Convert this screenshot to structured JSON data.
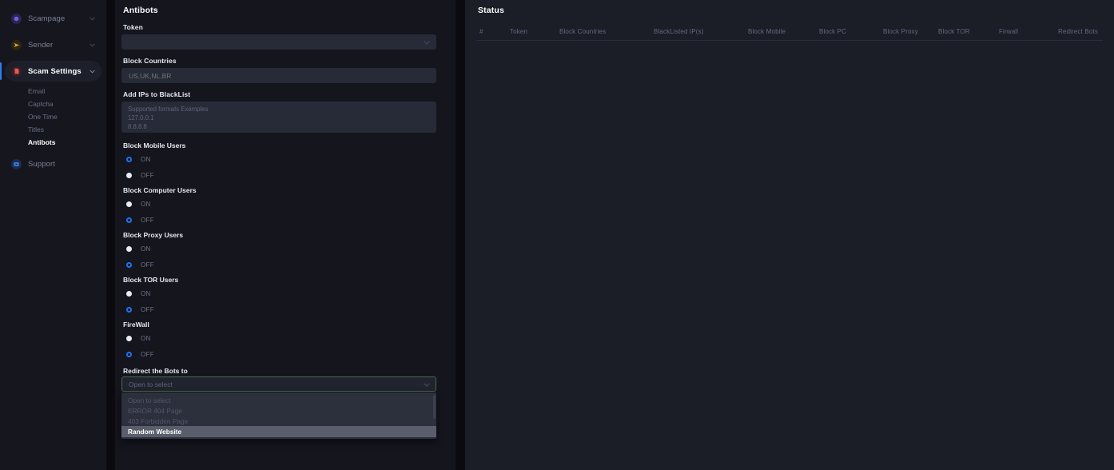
{
  "sidebar": {
    "items": [
      {
        "label": "Scampage",
        "icon": "scampage-icon",
        "badge_color": "#5b4ed6",
        "expandable": true,
        "active": false
      },
      {
        "label": "Sender",
        "icon": "send-icon",
        "badge_color": "#d99a2b",
        "expandable": true,
        "active": false
      },
      {
        "label": "Scam Settings",
        "icon": "document-icon",
        "badge_color": "#d9534f",
        "expandable": true,
        "active": true
      },
      {
        "label": "Support",
        "icon": "support-icon",
        "badge_color": "#2f6fd0",
        "expandable": false,
        "active": false
      }
    ],
    "subitems": [
      {
        "label": "Email",
        "active": false
      },
      {
        "label": "Captcha",
        "active": false
      },
      {
        "label": "One Time",
        "active": false
      },
      {
        "label": "Titles",
        "active": false
      },
      {
        "label": "Antibots",
        "active": true
      }
    ],
    "accent_color": "#2f7df6"
  },
  "antibots": {
    "title": "Antibots",
    "token": {
      "label": "Token",
      "value": "",
      "placeholder": ""
    },
    "block_countries": {
      "label": "Block Countries",
      "value": "",
      "placeholder": "US,UK,NL,BR"
    },
    "blacklist_ips": {
      "label": "Add IPs to BlackList",
      "value": "",
      "placeholder": "Supported formats Examples\n127.0.0.1\n8.8.8.8"
    },
    "toggles": [
      {
        "label": "Block Mobile Users",
        "on_label": "ON",
        "off_label": "OFF",
        "selected": "ON"
      },
      {
        "label": "Block Computer Users",
        "on_label": "ON",
        "off_label": "OFF",
        "selected": "OFF"
      },
      {
        "label": "Block Proxy Users",
        "on_label": "ON",
        "off_label": "OFF",
        "selected": "OFF"
      },
      {
        "label": "Block TOR Users",
        "on_label": "ON",
        "off_label": "OFF",
        "selected": "OFF"
      },
      {
        "label": "FireWall",
        "on_label": "ON",
        "off_label": "OFF",
        "selected": "OFF"
      }
    ],
    "redirect": {
      "label": "Redirect the Bots to",
      "selected_text": "Open to select",
      "open": true,
      "options": [
        {
          "label": "Open to select",
          "highlighted": false
        },
        {
          "label": "ERROR 404 Page",
          "highlighted": false
        },
        {
          "label": "403 Forbidden Page",
          "highlighted": false
        },
        {
          "label": "Random Website",
          "highlighted": true
        }
      ],
      "focus_border_color": "#4a6b4a",
      "highlight_color": "#5a5e6c"
    }
  },
  "status": {
    "title": "Status",
    "columns": [
      "#",
      "Token",
      "Block Countries",
      "BlackListed IP(s)",
      "Block Mobile",
      "Block PC",
      "Block Proxy",
      "Block TOR",
      "Firwall",
      "Redirect Bots"
    ],
    "rows": []
  },
  "theme": {
    "page_bg": "#0b0b0f",
    "sidebar_bg": "#15161e",
    "left_panel_bg": "#14151d",
    "right_panel_bg": "#1b1d27",
    "input_bg": "#272b38",
    "radio_selected": "#1f6feb"
  }
}
